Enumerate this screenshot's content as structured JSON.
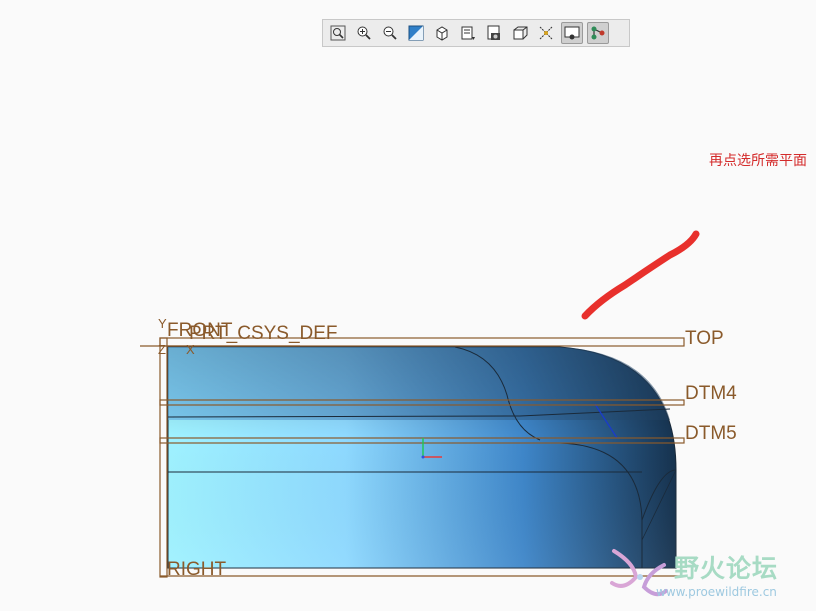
{
  "toolbar": {
    "buttons": [
      {
        "icon": "zoom-fit-icon"
      },
      {
        "icon": "zoom-in-icon"
      },
      {
        "icon": "zoom-out-icon"
      },
      {
        "icon": "repaint-icon"
      },
      {
        "icon": "view-orientation-icon"
      },
      {
        "icon": "saved-views-icon"
      },
      {
        "icon": "display-style-icon"
      },
      {
        "icon": "perspective-icon"
      },
      {
        "icon": "datum-display-icon"
      },
      {
        "icon": "spin-center-icon"
      },
      {
        "icon": "annotation-display-icon"
      }
    ]
  },
  "annotation": {
    "text": "再点选所需平面",
    "color": "#d42b2b"
  },
  "datum_labels": {
    "front": "FRONT",
    "csys": "PRT_CSYS_DEF",
    "top": "TOP",
    "dtm4": "DTM4",
    "dtm5": "DTM5",
    "right": "RIGHT"
  },
  "csys_axes": {
    "y": "Y",
    "z": "Z",
    "x": "X"
  },
  "watermark": {
    "name": "野火论坛",
    "url": "www.proewildfire.cn"
  },
  "colors": {
    "datum": "#8a5a2b",
    "model_dark": "#1a3654",
    "model_light": "#a6f0ff",
    "stroke": "#e8302c"
  }
}
